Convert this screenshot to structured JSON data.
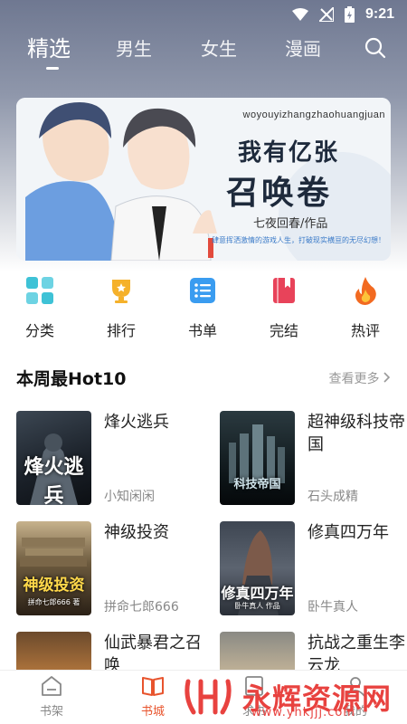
{
  "status_bar": {
    "time": "9:21"
  },
  "top_nav": {
    "tabs": [
      {
        "label": "精选",
        "active": true
      },
      {
        "label": "男生"
      },
      {
        "label": "女生"
      },
      {
        "label": "漫画"
      }
    ]
  },
  "banner": {
    "url_text": "woyouyizhangzhaohuangjuan",
    "title_line1": "我有亿张",
    "title_line2": "召唤卷",
    "author": "七夜回春/作品",
    "slogan": "肆意挥洒激情的游戏人生，打破现实横亘的无尽幻想！"
  },
  "categories": [
    {
      "label": "分类",
      "icon": "grid-icon",
      "color": "#3ec2d6"
    },
    {
      "label": "排行",
      "icon": "trophy-icon",
      "color": "#f5b12b"
    },
    {
      "label": "书单",
      "icon": "list-icon",
      "color": "#3a9cf0"
    },
    {
      "label": "完结",
      "icon": "book-icon",
      "color": "#e8435a"
    },
    {
      "label": "热评",
      "icon": "flame-icon",
      "color": "#f26a21"
    }
  ],
  "section": {
    "title": "本周最Hot10",
    "more": "查看更多"
  },
  "books": [
    {
      "title": "烽火逃兵",
      "author": "小知闲闲",
      "cover_text": "烽火逃兵"
    },
    {
      "title": "超神级科技帝国",
      "author": "石头成精",
      "cover_text": "科技帝国"
    },
    {
      "title": "神级投资",
      "author": "拼命七郎666",
      "cover_text": "神级投资",
      "cover_sub": "拼命七郎666 著"
    },
    {
      "title": "修真四万年",
      "author": "卧牛真人",
      "cover_text": "修真四万年",
      "cover_sub": "卧牛真人 作品"
    },
    {
      "title": "仙武暴君之召唤",
      "author": ""
    },
    {
      "title": "抗战之重生李云龙",
      "author": ""
    }
  ],
  "bottom_nav": [
    {
      "label": "书架",
      "icon": "bookshelf-icon"
    },
    {
      "label": "书城",
      "icon": "open-book-icon",
      "active": true
    },
    {
      "label": "求书",
      "icon": "request-icon"
    },
    {
      "label": "我的",
      "icon": "profile-icon"
    }
  ],
  "watermark": {
    "text": "永辉资源网",
    "url": "www.yhkjjj.com"
  },
  "colors": {
    "accent": "#e8542d",
    "hero_bg": "#7f88a0"
  }
}
